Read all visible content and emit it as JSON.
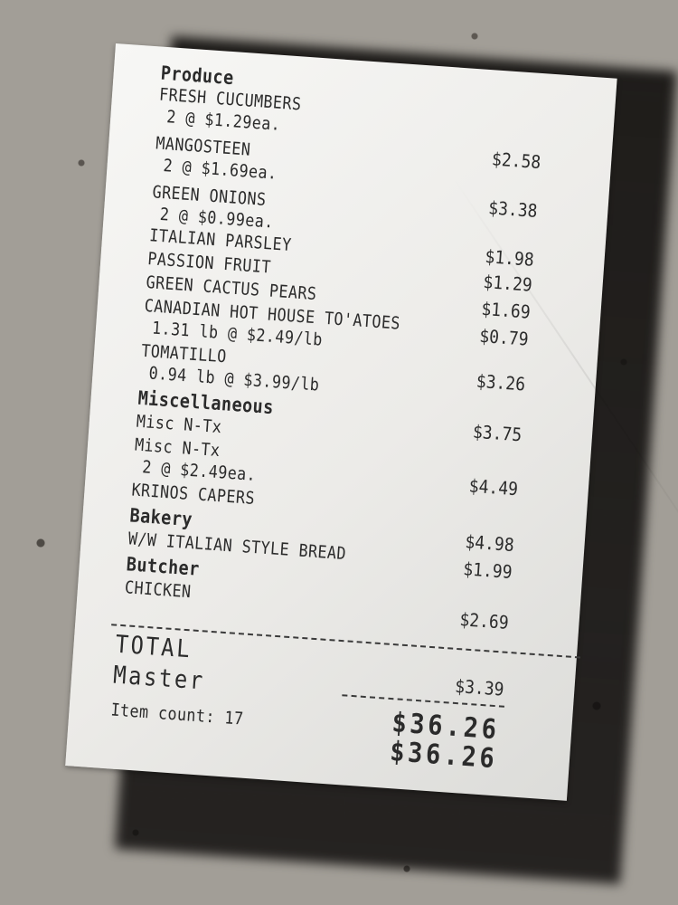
{
  "receipt": {
    "produce_header": "Produce",
    "items": [
      {
        "name": "FRESH CUCUMBERS",
        "detail": "2 @ $1.29ea.",
        "price": "$2.58"
      },
      {
        "name": "MANGOSTEEN",
        "detail": "2 @ $1.69ea.",
        "price": "$3.38"
      },
      {
        "name": "GREEN ONIONS",
        "detail": "2 @ $0.99ea.",
        "price": "$1.98"
      },
      {
        "name": "ITALIAN  PARSLEY",
        "price": "$1.29"
      },
      {
        "name": "PASSION FRUIT",
        "price": "$1.69"
      },
      {
        "name": "GREEN CACTUS PEARS",
        "price": "$0.79"
      },
      {
        "name": "CANADIAN HOT HOUSE TO'ATOES",
        "detail": "1.31 lb @ $2.49/lb",
        "price": "$3.26"
      },
      {
        "name": "TOMATILLO",
        "detail": "0.94 lb @ $3.99/lb",
        "price": "$3.75"
      }
    ],
    "misc_header": "Miscellaneous",
    "misc_items": [
      {
        "name": "Misc N-Tx",
        "price": "$4.49"
      },
      {
        "name": "Misc N-Tx",
        "detail": "2 @ $2.49ea.",
        "price": "$4.98"
      },
      {
        "name": "KRINOS CAPERS",
        "price": "$1.99"
      }
    ],
    "bakery_header": "Bakery",
    "bakery_items": [
      {
        "name": "W/W ITALIAN STYLE BREAD",
        "price": "$2.69"
      }
    ],
    "butcher_header": "Butcher",
    "butcher_items": [
      {
        "name": "CHICKEN",
        "price": "$3.39"
      }
    ],
    "total_label": "TOTAL",
    "total_value": "$36.26",
    "payment_label": "Master",
    "payment_value": "$36.26",
    "item_count": "Item count: 17"
  }
}
